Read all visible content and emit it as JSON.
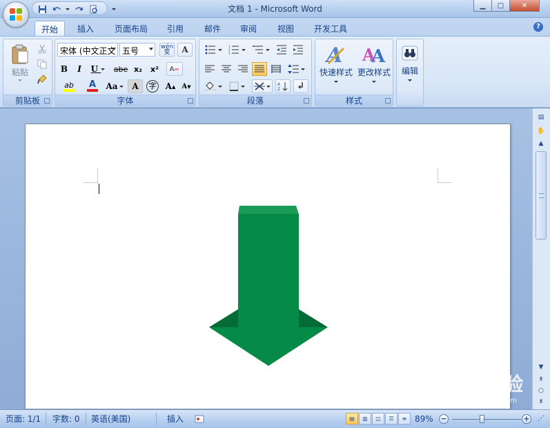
{
  "window": {
    "title": "文档 1 - Microsoft Word",
    "controls": {
      "minimize": "▁",
      "maximize": "□",
      "close": "✕"
    }
  },
  "tabs": [
    "开始",
    "插入",
    "页面布局",
    "引用",
    "邮件",
    "审阅",
    "视图",
    "开发工具"
  ],
  "active_tab": "开始",
  "ribbon": {
    "clipboard": {
      "label": "剪贴板",
      "paste_label": "粘贴"
    },
    "font": {
      "label": "字体",
      "font_name": "宋体 (中文正文",
      "font_size": "五号",
      "phonetic_glyph": "wén 变",
      "border_glyph": "A",
      "bold": "B",
      "italic": "I",
      "underline": "U",
      "strike": "abe",
      "subscript": "x₂",
      "superscript": "x²",
      "clear": "A",
      "highlight": "ab",
      "font_color": "A",
      "change_case": "Aa",
      "char_shade": "A",
      "enclose": "字",
      "grow": "A",
      "shrink": "A"
    },
    "paragraph": {
      "label": "段落"
    },
    "styles": {
      "label": "样式",
      "quick_styles": "快速样式",
      "change_styles": "更改样式"
    },
    "editing": {
      "label": "编辑"
    }
  },
  "colors": {
    "arrow_front": "#068a47",
    "arrow_side": "#036b35",
    "arrow_top": "#1a9c56",
    "highlight_swatch": "#ffff00",
    "font_color_swatch": "#e02020"
  },
  "statusbar": {
    "page": "页面: 1/1",
    "words": "字数: 0",
    "language": "英语(美国)",
    "mode": "插入",
    "zoom": "89%",
    "zoom_level": 89
  },
  "watermark": {
    "text": "Bai du 经验",
    "sub": "jingyan.baidu.com"
  }
}
